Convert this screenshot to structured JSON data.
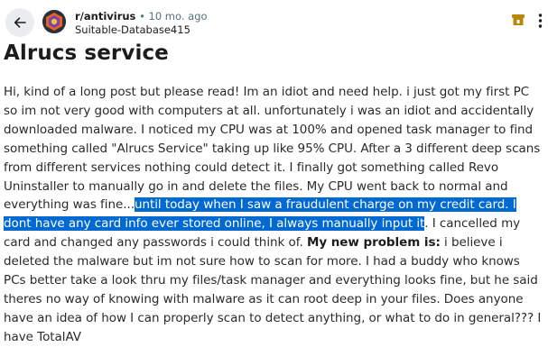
{
  "post": {
    "subreddit": "r/antivirus",
    "separator": "•",
    "time": "10 mo. ago",
    "username": "Suitable-Database415",
    "title": "Alrucs service"
  },
  "body": {
    "p1": "Hi, kind of a long post but please read! Im an idiot and need help. i just got my first PC so im not very good with computers at all. unfortunately i was an idiot and accidentally downloaded malware. I noticed my CPU was at 100% and opened task manager to find something called \"Alrucs Service\" taking up like 95% CPU. After a 3 different deep scans from different services nothing could detect it. I finally got something called Revo Uninstaller to manually go in and delete the files. My CPU went back to normal and everything was fine...",
    "p2_highlight": "until today when I saw a fraudulent charge on my credit card. I dont have any card info ever stored online, I always manually input it",
    "p3": ". I cancelled my card and changed any passwords i could think of. ",
    "p4_bold": "My new problem is:",
    "p5": " i believe i deleted the malware but im not sure how to scan for more. I had a buddy who knows PCs better take a look thru my files/task manager and everything looks fine, but he said theres no way of knowing with malware as it can root deep in your files. Does anyone have an idea of how I can properly scan to detect anything, or what to do in general??? I have TotalAV"
  },
  "icons": {
    "back": "arrow-left-icon",
    "avatar": "subreddit-avatar-icon",
    "flair": "award-icon",
    "more": "more-vertical-icon"
  },
  "colors": {
    "accent": "#0069d2",
    "flair": "#b8860b",
    "meta": "#576f76"
  }
}
